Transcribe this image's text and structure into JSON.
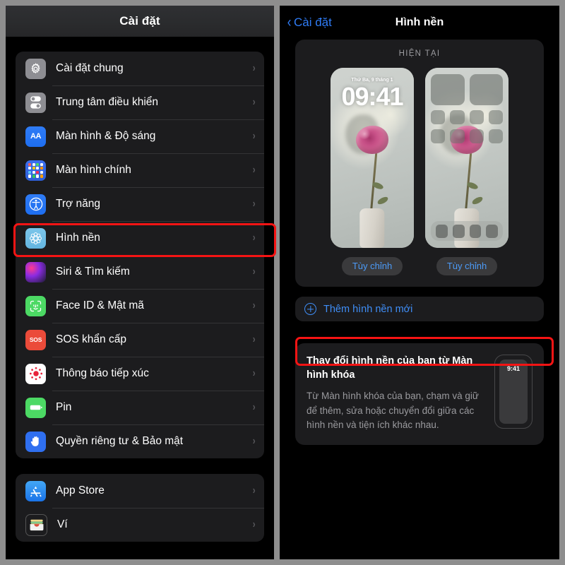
{
  "left": {
    "navbar": {
      "title": "Cài đặt"
    },
    "groups": [
      {
        "rows": [
          {
            "label": "Cài đặt chung",
            "icon": "gear-icon"
          },
          {
            "label": "Trung tâm điều khiển",
            "icon": "control-center-icon"
          },
          {
            "label": "Màn hình & Độ sáng",
            "icon": "display-brightness-icon"
          },
          {
            "label": "Màn hình chính",
            "icon": "home-screen-icon"
          },
          {
            "label": "Trợ năng",
            "icon": "accessibility-icon"
          },
          {
            "label": "Hình nền",
            "icon": "wallpaper-icon"
          },
          {
            "label": "Siri & Tìm kiếm",
            "icon": "siri-icon"
          },
          {
            "label": "Face ID & Mật mã",
            "icon": "face-id-icon"
          },
          {
            "label": "SOS khẩn cấp",
            "icon": "sos-icon"
          },
          {
            "label": "Thông báo tiếp xúc",
            "icon": "exposure-notification-icon"
          },
          {
            "label": "Pin",
            "icon": "battery-icon"
          },
          {
            "label": "Quyền riêng tư & Bảo mật",
            "icon": "privacy-hand-icon"
          }
        ]
      },
      {
        "rows": [
          {
            "label": "App Store",
            "icon": "app-store-icon"
          },
          {
            "label": "Ví",
            "icon": "wallet-icon"
          }
        ]
      }
    ],
    "sos_icon_text": "SOS",
    "display_icon_text": "AA"
  },
  "right": {
    "navbar": {
      "back_label": "Cài đặt",
      "title": "Hình nền"
    },
    "current_section": {
      "header": "HIỆN TẠI",
      "lock_preview": {
        "date": "Thứ Ba, 9 tháng 1",
        "time": "09:41"
      },
      "customize_lock_label": "Tùy chỉnh",
      "customize_home_label": "Tùy chỉnh"
    },
    "add_wallpaper": {
      "label": "Thêm hình nền mới",
      "icon": "plus-circle-icon"
    },
    "info_card": {
      "title": "Thay đổi hình nền của bạn từ Màn hình khóa",
      "body": "Từ Màn hình khóa của bạn, chạm và giữ để thêm, sửa hoặc chuyển đổi giữa các hình nền và tiện ích khác nhau.",
      "mini_phone_time": "9:41"
    }
  },
  "highlights": {
    "wallpaper_row": "#F51414",
    "add_wallpaper_row": "#F51414"
  },
  "chevron_glyph": "›"
}
